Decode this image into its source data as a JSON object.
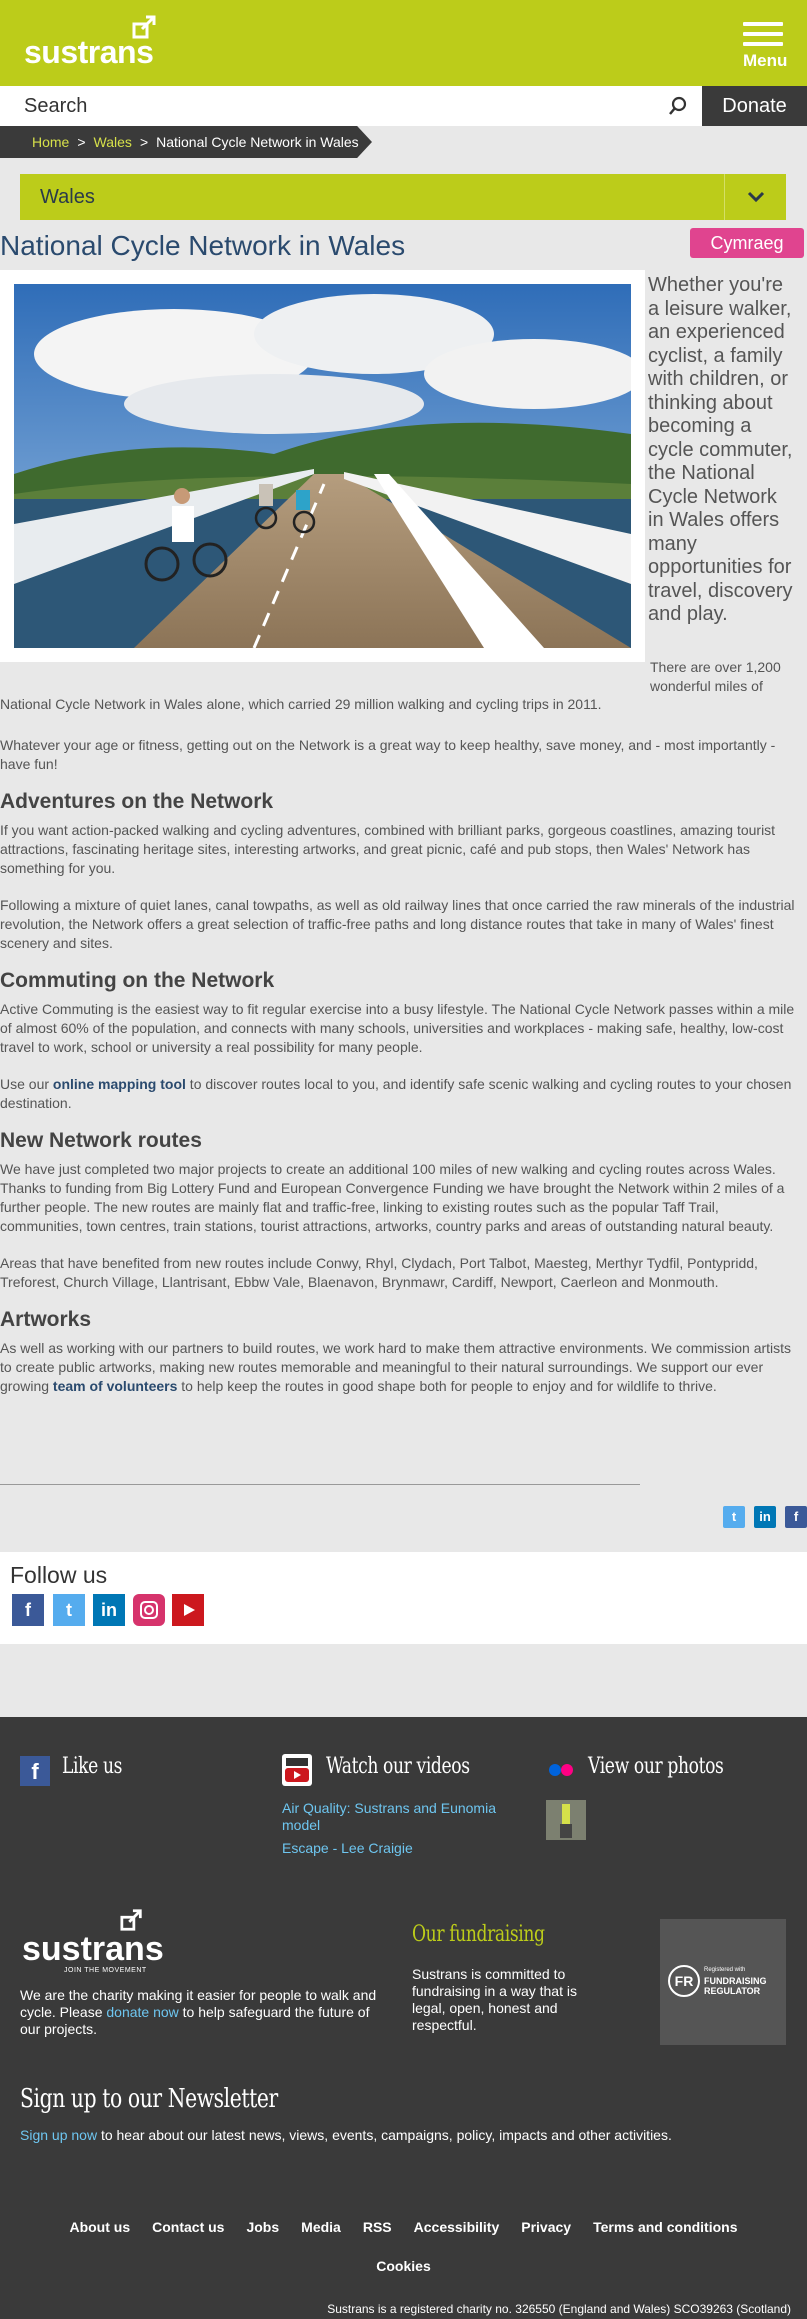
{
  "header": {
    "logo": "sustrans",
    "menu_label": "Menu"
  },
  "search": {
    "placeholder": "Search",
    "donate_label": "Donate"
  },
  "breadcrumb": {
    "home": "Home",
    "sep": ">",
    "wales": "Wales",
    "current": "National Cycle Network in Wales"
  },
  "region_select": {
    "value": "Wales"
  },
  "page": {
    "title": "National Cycle Network in Wales",
    "lang_button": "Cymraeg"
  },
  "intro": {
    "lead": "Whether you're a leisure walker, an experienced cyclist, a family with children, or thinking about becoming a cycle commuter, the National Cycle Network in Wales offers many opportunities for travel, discovery and play.",
    "stat_a": "There are over 1,200 wonderful miles of",
    "stat_b": "National Cycle Network in Wales alone,  which carried 29 million walking and cycling trips in 2011.",
    "p2": "Whatever your age or fitness, getting out on the Network is a great way to keep healthy, save money, and - most importantly - have fun!"
  },
  "adventures": {
    "heading": "Adventures on the Network",
    "p1": "If you want action-packed walking and cycling adventures, combined with brilliant parks, gorgeous coastlines, amazing tourist attractions, fascinating heritage sites, interesting artworks, and great picnic, café and pub stops, then Wales' Network has something for you.",
    "p2": "Following a mixture of quiet lanes, canal towpaths, as well as old railway lines that once carried the raw minerals of the industrial revolution, the Network offers a great selection of traffic-free paths and long distance routes that take in many of Wales' finest scenery and sites."
  },
  "commuting": {
    "heading": "Commuting on the Network",
    "p1": "Active Commuting is the easiest way to fit regular exercise into a busy lifestyle. The National Cycle Network passes within a mile of almost 60% of the population, and connects with many schools, universities and workplaces - making safe, healthy, low-cost travel to work, school or university a real possibility for many people.",
    "p2_pre": "Use our ",
    "p2_link": "online mapping tool",
    "p2_post": " to discover routes local to you, and identify safe scenic walking and cycling routes to your chosen destination."
  },
  "new_routes": {
    "heading": "New Network routes",
    "p1": "We have just completed two major projects to create an additional 100 miles of new walking and cycling routes across Wales. Thanks to funding from Big Lottery Fund and European Convergence Funding we have brought the Network within 2 miles of a further people. The new routes are mainly flat and traffic-free, linking to existing routes such as the popular Taff Trail, communities, town centres, train stations, tourist attractions, artworks, country parks and areas of outstanding natural beauty.",
    "p2": "Areas that have benefited from new routes include Conwy, Rhyl, Clydach, Port Talbot, Maesteg, Merthyr Tydfil, Pontypridd, Treforest, Church Village, Llantrisant, Ebbw Vale, Blaenavon, Brynmawr, Cardiff, Newport, Caerleon and Monmouth."
  },
  "artworks": {
    "heading": "Artworks",
    "p1_pre": "As well as working with our partners to build routes, we work hard to make them attractive environments. We commission artists to create public artworks, making new routes memorable and meaningful to their natural surroundings. We support our ever growing ",
    "p1_link": "team of volunteers",
    "p1_post": " to help keep the routes in good shape both for people to enjoy and for wildlife to thrive."
  },
  "share_icons": [
    "twitter-icon",
    "linkedin-icon",
    "facebook-icon"
  ],
  "follow": {
    "heading": "Follow us",
    "icons": [
      "facebook-icon",
      "twitter-icon",
      "linkedin-icon",
      "instagram-icon",
      "youtube-icon"
    ]
  },
  "footer": {
    "like_us": "Like us",
    "watch": "Watch our videos",
    "video1": "Air Quality: Sustrans and Eunomia model",
    "video2": "Escape - Lee Craigie",
    "photos": "View our photos",
    "logo": "sustrans",
    "tagline": "JOIN THE MOVEMENT",
    "about_pre": "We are the charity making it easier for people to walk and cycle. Please ",
    "about_link": "donate now",
    "about_post": " to help safeguard the future of our projects.",
    "fundraising_heading": "Our fundraising",
    "fundraising_text": "Sustrans is committed to fundraising in a way that is legal, open, honest and respectful.",
    "regulator_small": "Registered with",
    "regulator_big": "FUNDRAISING REGULATOR",
    "regulator_mark": "FR",
    "newsletter_heading": "Sign up to our Newsletter",
    "newsletter_link": "Sign up now",
    "newsletter_text": " to hear about our latest news, views, events, campaigns, policy, impacts and other activities.",
    "nav": [
      "About us",
      "Contact us",
      "Jobs",
      "Media",
      "RSS",
      "Accessibility",
      "Privacy",
      "Terms and conditions"
    ],
    "cookies": "Cookies",
    "charity": "Sustrans is a registered charity no. 326550 (England and Wales) SCO39263 (Scotland)"
  },
  "colors": {
    "brand_green": "#bccc1a",
    "dark": "#3a3a3a",
    "pink": "#e0448f",
    "link": "#2a4a6e",
    "footer_link": "#6ec6f0"
  }
}
